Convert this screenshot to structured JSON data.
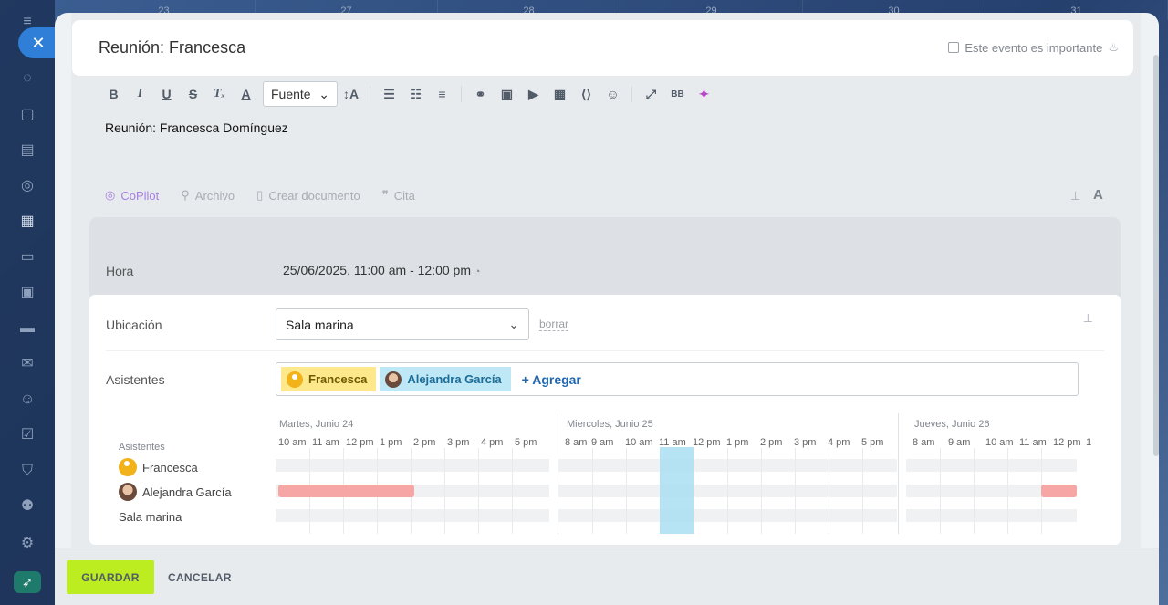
{
  "background": {
    "day_numbers": [
      "23",
      "27",
      "28",
      "29",
      "30",
      "31"
    ]
  },
  "header": {
    "title": "Reunión: Francesca",
    "important_label": "Este evento es importante"
  },
  "toolbar": {
    "font_label": "Fuente"
  },
  "editor": {
    "text": "Reunión: Francesca Domínguez"
  },
  "actions": {
    "copilot": "CoPilot",
    "archivo": "Archivo",
    "crear_documento": "Crear documento",
    "cita": "Cita"
  },
  "hora": {
    "label": "Hora",
    "value": "25/06/2025, 11:00 am - 12:00 pm"
  },
  "ubicacion": {
    "label": "Ubicación",
    "value": "Sala marina",
    "clear": "borrar"
  },
  "asistentes": {
    "label": "Asistentes",
    "tags": [
      "Francesca",
      "Alejandra García"
    ],
    "add": "+ Agregar"
  },
  "timeline": {
    "rows_label": "Asistentes",
    "rows": [
      "Francesca",
      "Alejandra García",
      "Sala marina"
    ],
    "days": [
      {
        "label": "Martes, Junio 24",
        "hours": [
          "10 am",
          "11 am",
          "12 pm",
          "1 pm",
          "2 pm",
          "3 pm",
          "4 pm",
          "5 pm"
        ]
      },
      {
        "label": "Miercoles, Junio 25",
        "hours": [
          "8 am",
          "9 am",
          "10 am",
          "11 am",
          "12 pm",
          "1 pm",
          "2 pm",
          "3 pm",
          "4 pm",
          "5 pm"
        ]
      },
      {
        "label": "Jueves, Junio 26",
        "hours": [
          "8 am",
          "9 am",
          "10 am",
          "11 am",
          "12 pm",
          "1"
        ]
      }
    ]
  },
  "footer": {
    "save": "GUARDAR",
    "cancel": "CANCELAR"
  },
  "colors": {
    "save_button": "#bbed21",
    "busy": "#f7a6a6",
    "current_slot": "#a9dff3",
    "tag_yellow": "#fde98c",
    "tag_blue": "#bfe8f7"
  }
}
